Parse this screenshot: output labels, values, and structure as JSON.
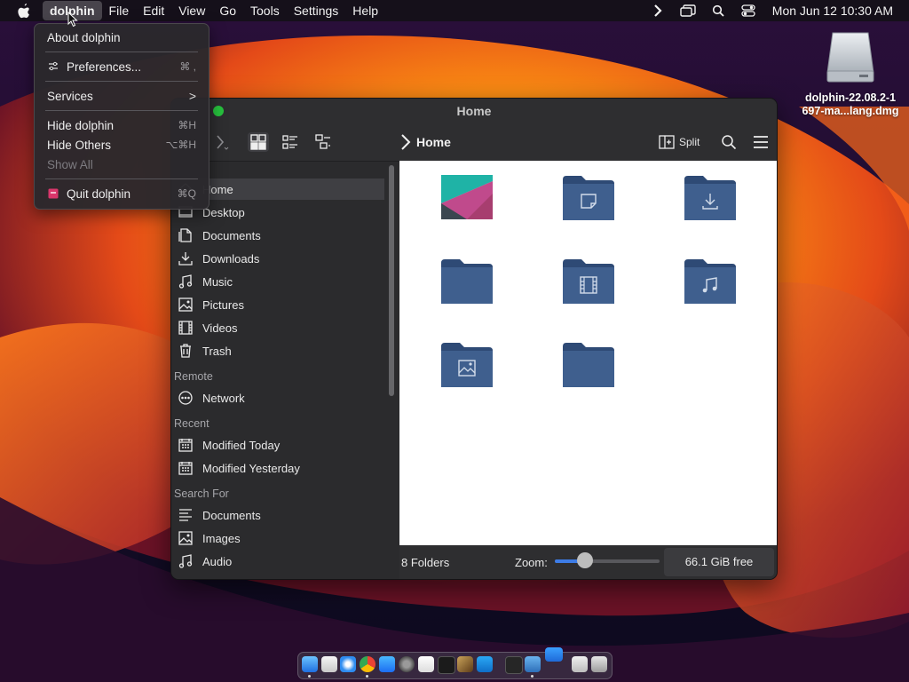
{
  "menubar": {
    "app_name": "dolphin",
    "menus": [
      "File",
      "Edit",
      "View",
      "Go",
      "Tools",
      "Settings",
      "Help"
    ],
    "clock": "Mon Jun 12  10:30 AM",
    "icons": [
      "apple-icon",
      "chevron-right-icon",
      "window-icon",
      "spotlight-search-icon",
      "control-center-icon"
    ]
  },
  "app_menu": {
    "items": [
      {
        "label": "About dolphin",
        "shortcut": ""
      },
      {
        "label": "Preferences...",
        "shortcut": "⌘ ,"
      },
      {
        "label": "Services",
        "shortcut": ">"
      },
      {
        "label": "Hide dolphin",
        "shortcut": "⌘H"
      },
      {
        "label": "Hide Others",
        "shortcut": "⌥⌘H"
      },
      {
        "label": "Show All",
        "shortcut": ""
      },
      {
        "label": "Quit dolphin",
        "shortcut": "⌘Q"
      }
    ]
  },
  "window": {
    "title": "Home",
    "breadcrumb": "Home",
    "split_label": "Split",
    "sidebar": {
      "places": [
        {
          "label": "Home",
          "icon": "home-icon"
        },
        {
          "label": "Desktop",
          "icon": "desktop-icon"
        },
        {
          "label": "Documents",
          "icon": "documents-icon"
        },
        {
          "label": "Downloads",
          "icon": "downloads-icon"
        },
        {
          "label": "Music",
          "icon": "music-icon"
        },
        {
          "label": "Pictures",
          "icon": "pictures-icon"
        },
        {
          "label": "Videos",
          "icon": "videos-icon"
        },
        {
          "label": "Trash",
          "icon": "trash-icon"
        }
      ],
      "remote_header": "Remote",
      "remote": [
        {
          "label": "Network",
          "icon": "network-icon"
        }
      ],
      "recent_header": "Recent",
      "recent": [
        {
          "label": "Modified Today",
          "icon": "calendar-icon"
        },
        {
          "label": "Modified Yesterday",
          "icon": "calendar-icon"
        }
      ],
      "search_header": "Search For",
      "search": [
        {
          "label": "Documents",
          "icon": "text-lines-icon"
        },
        {
          "label": "Images",
          "icon": "image-icon"
        },
        {
          "label": "Audio",
          "icon": "music-icon"
        }
      ]
    },
    "files": [
      {
        "type": "image",
        "icon": "image-thumbnail-icon"
      },
      {
        "type": "folder",
        "icon": "folder-documents-icon"
      },
      {
        "type": "folder",
        "icon": "folder-downloads-icon"
      },
      {
        "type": "folder",
        "icon": "folder-icon"
      },
      {
        "type": "folder",
        "icon": "folder-videos-icon"
      },
      {
        "type": "folder",
        "icon": "folder-music-icon"
      },
      {
        "type": "folder",
        "icon": "folder-pictures-icon"
      },
      {
        "type": "folder",
        "icon": "folder-icon"
      }
    ],
    "status": {
      "folder_count": "8 Folders",
      "zoom_label": "Zoom:",
      "zoom_fraction": 0.29,
      "free_space": "66.1 GiB free"
    }
  },
  "desktop": {
    "disk_label": "dolphin-22.08.2-1 697-ma...lang.dmg"
  },
  "dock": {
    "apps": [
      "finder",
      "launchpad",
      "safari",
      "chrome",
      "app-store",
      "system-preferences",
      "textedit",
      "terminal",
      "brush",
      "vscode",
      "terminal-2",
      "dolphin",
      "stacked-windows",
      "keyboard-viewer",
      "trash"
    ]
  },
  "colors": {
    "folder": "#3f5f8e",
    "folder_tab": "#2e4a75",
    "accent": "#3d7ce6",
    "close_green": "#27c23e"
  }
}
